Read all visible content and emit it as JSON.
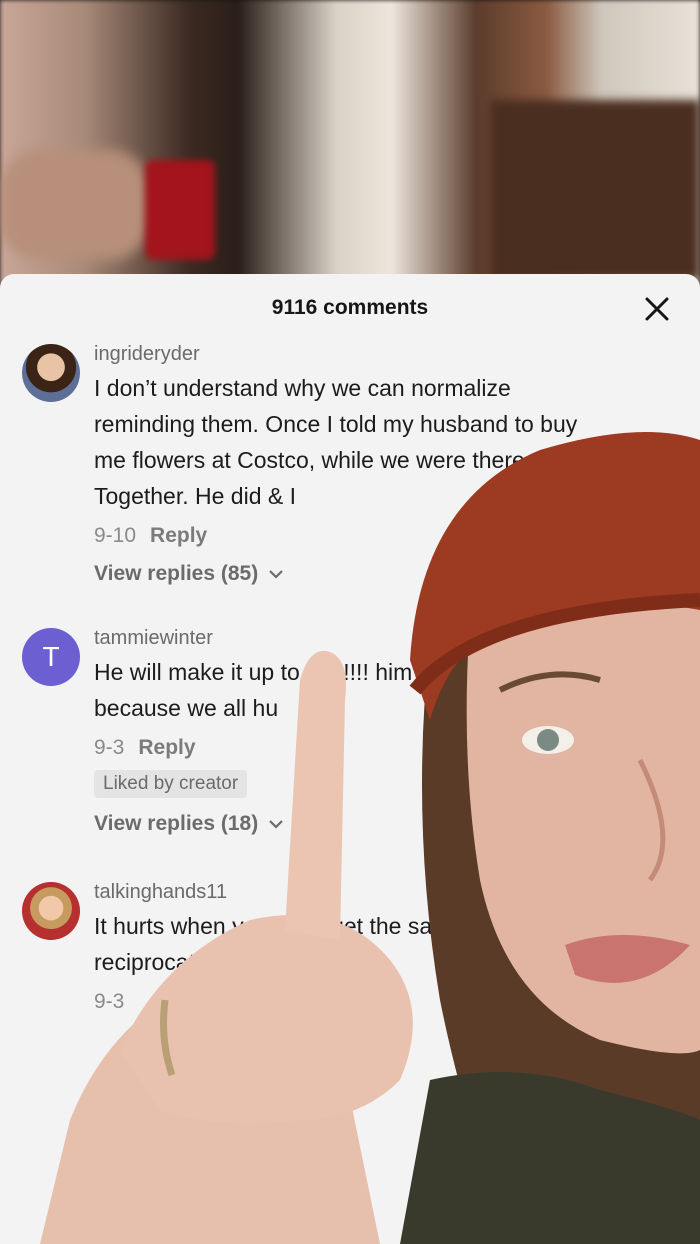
{
  "comments_panel": {
    "count_label": "9116 comments",
    "comments": [
      {
        "username": "ingrideryder",
        "text": "I don’t understand why we can normalize reminding them. Once I told my husband to buy me flowers at Costco, while we were there. Together. He did & I",
        "date": "9-10",
        "reply_label": "Reply",
        "view_replies_label": "View replies (85)"
      },
      {
        "username": "tammiewinter",
        "avatar_letter": "T",
        "text": "He will make it up to you!!!! him , because we all hu",
        "date": "9-3",
        "reply_label": "Reply",
        "liked_label": "Liked by creator",
        "view_replies_label": "View replies (18)"
      },
      {
        "username": "talkinghands11",
        "text": "It hurts when you don't get the same reciprocation",
        "date": "9-3"
      }
    ]
  },
  "colors": {
    "sheet_bg": "#f3f3f3",
    "avatar_letter_bg": "#6b5fd1",
    "beanie": "#9c3a22"
  },
  "icons": {
    "close": "close-icon",
    "chevron": "chevron-down-icon"
  }
}
